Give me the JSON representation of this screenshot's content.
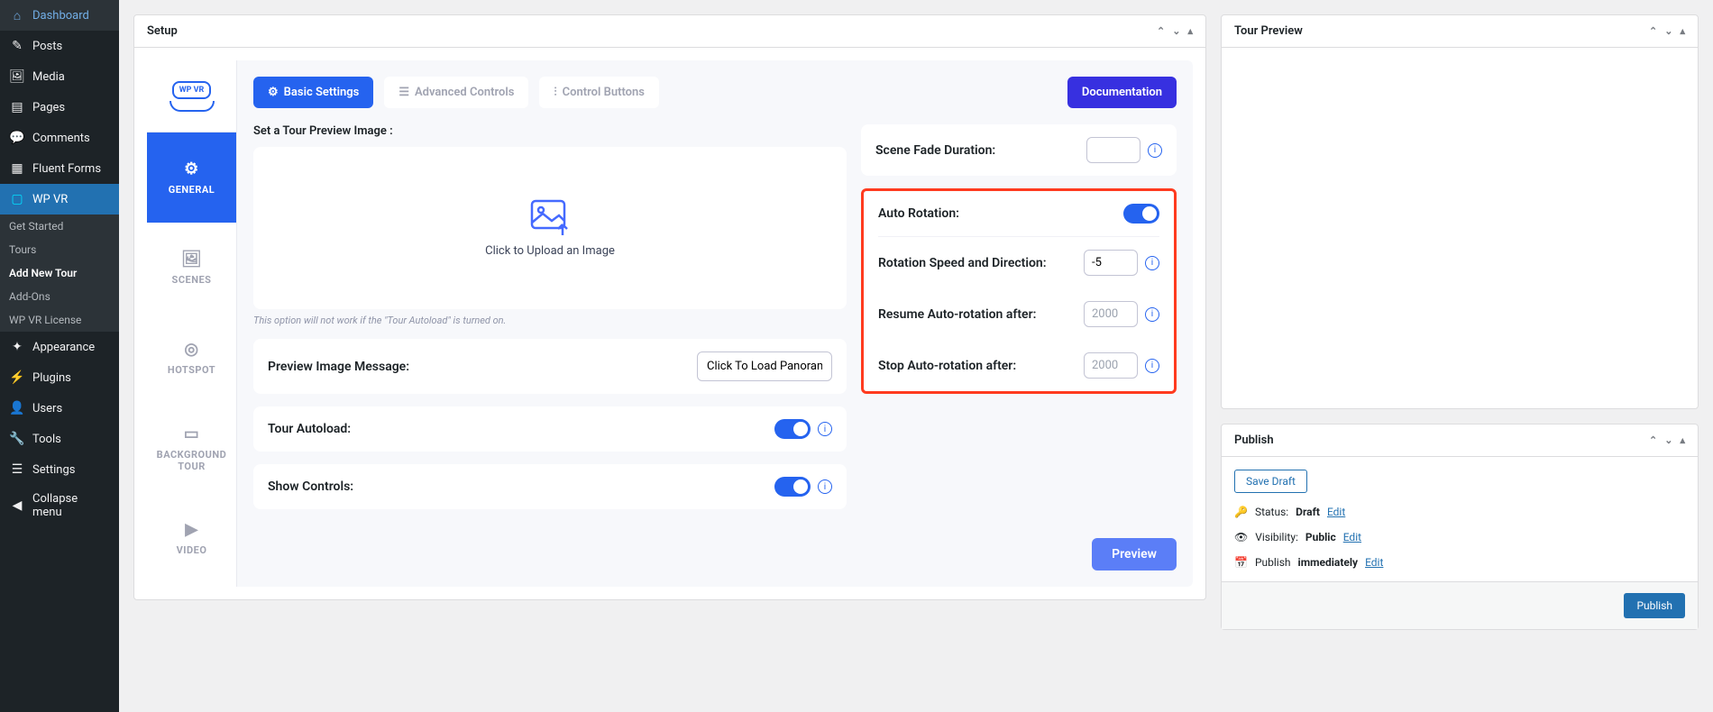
{
  "sidebar": {
    "dashboard": "Dashboard",
    "posts": "Posts",
    "media": "Media",
    "pages": "Pages",
    "comments": "Comments",
    "fluent_forms": "Fluent Forms",
    "wpvr": "WP VR",
    "wpvr_sub": {
      "get_started": "Get Started",
      "tours": "Tours",
      "add_new": "Add New Tour",
      "addons": "Add-Ons",
      "license": "WP VR License"
    },
    "appearance": "Appearance",
    "plugins": "Plugins",
    "users": "Users",
    "tools": "Tools",
    "settings": "Settings",
    "collapse": "Collapse menu"
  },
  "setup": {
    "title": "Setup",
    "logo_text": "WP VR",
    "tabs": {
      "general": "GENERAL",
      "scenes": "SCENES",
      "hotspot": "HOTSPOT",
      "bgtour": "BACKGROUND TOUR",
      "video": "VIDEO"
    },
    "top_buttons": {
      "basic": "Basic Settings",
      "advanced": "Advanced Controls",
      "control": "Control Buttons",
      "docs": "Documentation"
    },
    "preview_label": "Set a Tour Preview Image :",
    "upload_text": "Click to Upload an Image",
    "upload_hint": "This option will not work if the \"Tour Autoload\" is turned on.",
    "preview_msg_label": "Preview Image Message:",
    "preview_msg_value": "Click To Load Panoram",
    "autoload_label": "Tour Autoload:",
    "show_controls_label": "Show Controls:",
    "scene_fade_label": "Scene Fade Duration:",
    "auto_rotation_label": "Auto Rotation:",
    "rotation_speed_label": "Rotation Speed and Direction:",
    "rotation_speed_value": "-5",
    "resume_label": "Resume Auto-rotation after:",
    "resume_placeholder": "2000",
    "stop_label": "Stop Auto-rotation after:",
    "stop_placeholder": "2000",
    "preview_btn": "Preview"
  },
  "tour_preview": {
    "title": "Tour Preview"
  },
  "publish": {
    "title": "Publish",
    "save_draft": "Save Draft",
    "status_label": "Status: ",
    "status_value": "Draft",
    "visibility_label": "Visibility: ",
    "visibility_value": "Public",
    "publish_label": "Publish ",
    "publish_value": "immediately",
    "edit": "Edit",
    "publish_btn": "Publish"
  }
}
